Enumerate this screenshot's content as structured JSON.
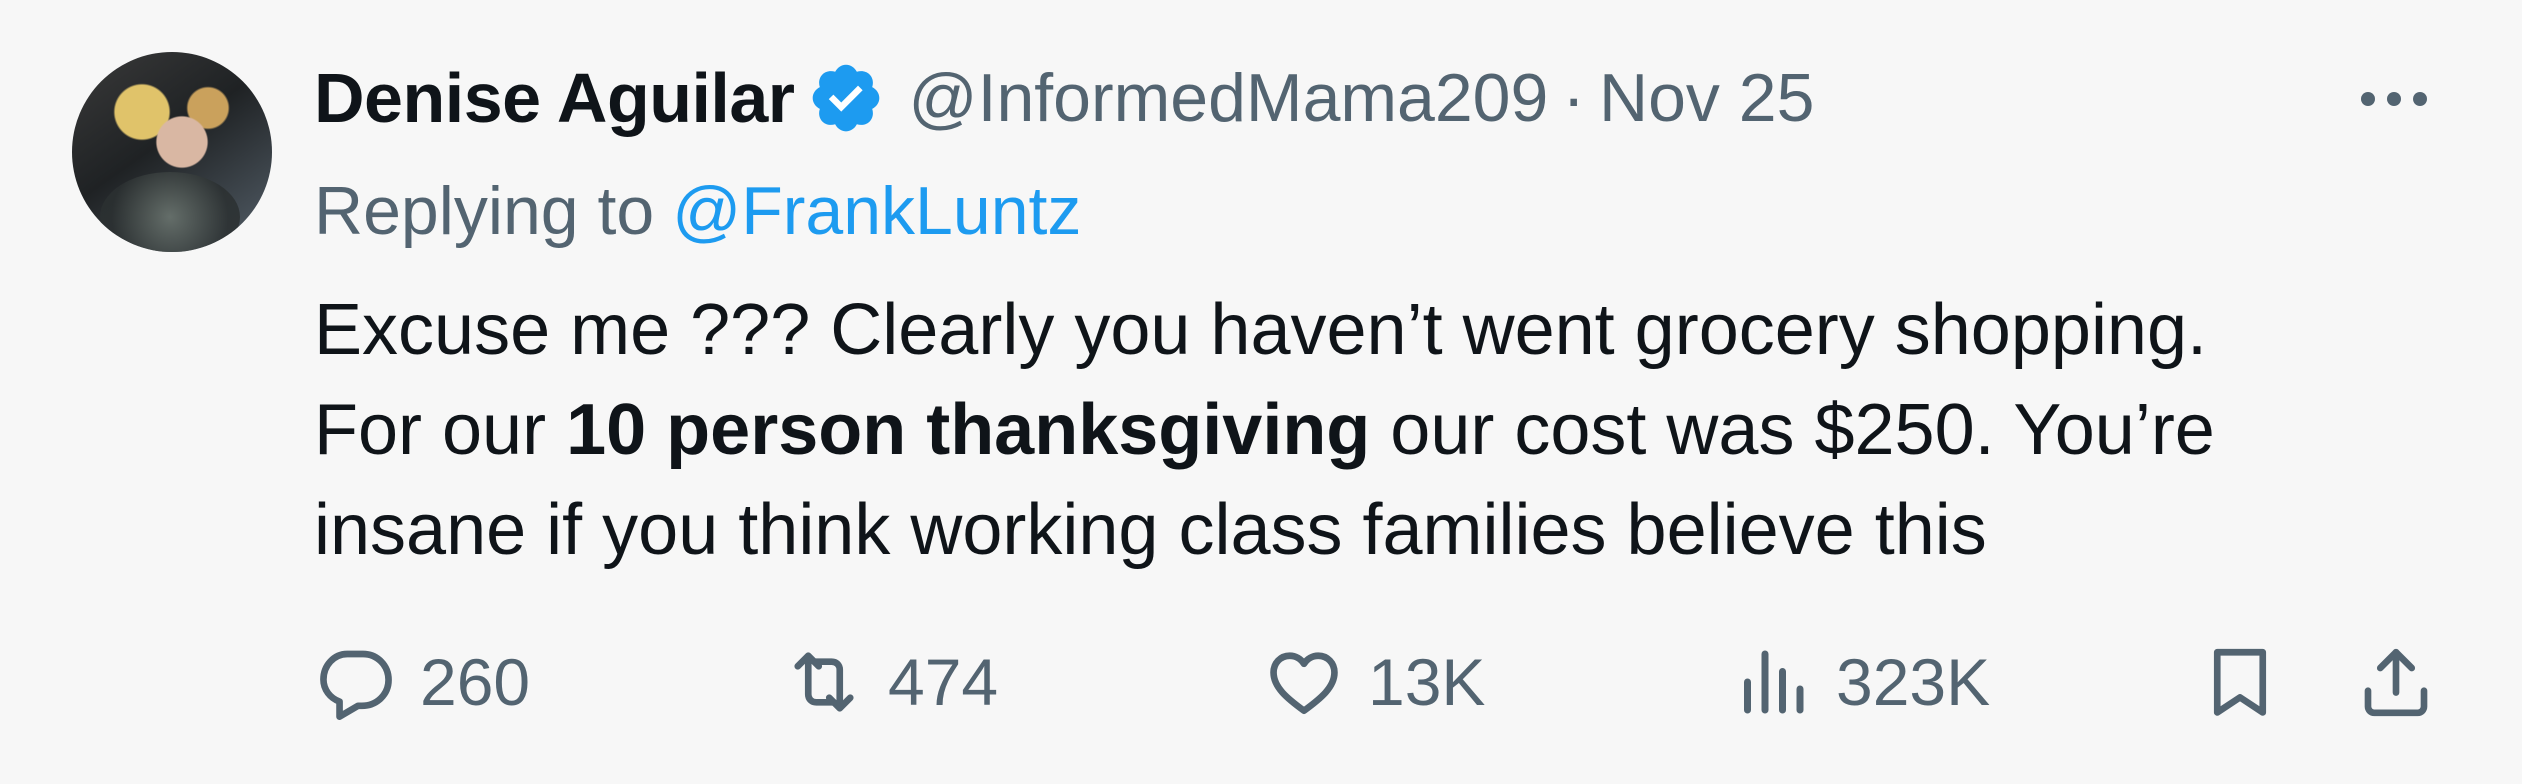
{
  "author": {
    "name": "Denise Aguilar",
    "handle": "@InformedMama209",
    "separator": "·",
    "time": "Nov 25"
  },
  "reply": {
    "prefix": "Replying to",
    "target": "@FrankLuntz"
  },
  "tweet": {
    "line1": "Excuse me ???  Clearly you haven’t went grocery shopping.",
    "line2_before": "For our ",
    "line2_bold": "10 person thanksgiving",
    "line2_after": " our cost was $250. You’re",
    "line3": "insane if you think working class families believe this"
  },
  "stats": {
    "replies": "260",
    "retweets": "474",
    "likes": "13K",
    "views": "323K"
  },
  "icons": {
    "verified": "verified-badge-icon",
    "more": "more-horizontal-icon",
    "reply": "reply-bubble-icon",
    "retweet": "retweet-icon",
    "like": "heart-icon",
    "views": "bar-chart-icon",
    "bookmark": "bookmark-icon",
    "share": "share-upload-icon"
  },
  "colors": {
    "background": "#f7f7f7",
    "text": "#0f1419",
    "secondary": "#536471",
    "link": "#1d9bf0"
  }
}
